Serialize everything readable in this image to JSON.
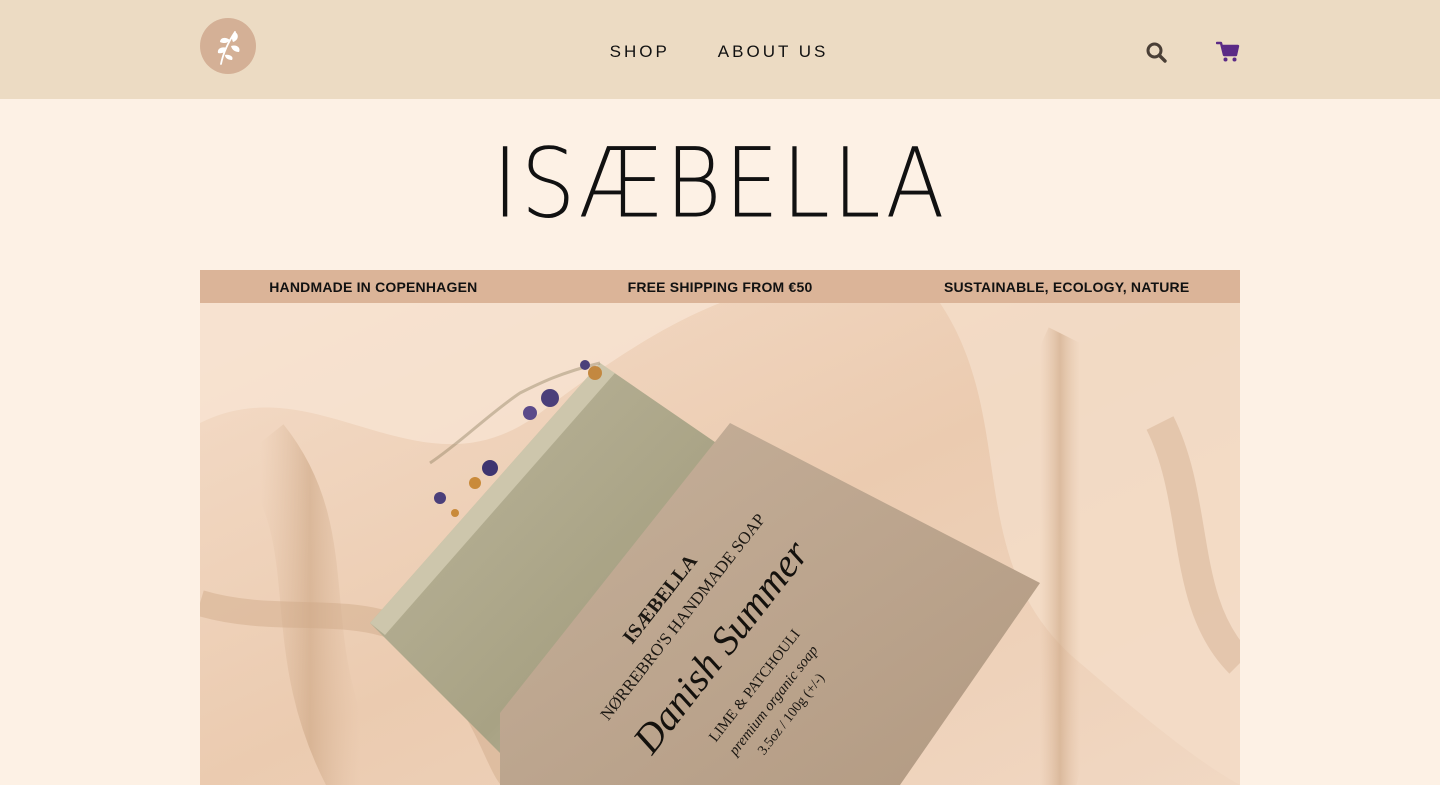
{
  "nav": {
    "links": [
      "SHOP",
      "ABOUT US"
    ],
    "logo_icon": "leaf-icon",
    "search_icon": "search-icon",
    "cart_icon": "cart-icon",
    "cart_color": "#5b2a86"
  },
  "brand": {
    "title": "ISÆBELLA"
  },
  "banner": {
    "items": [
      "HANDMADE IN COPENHAGEN",
      "FREE SHIPPING FROM €50",
      "SUSTAINABLE, ECOLOGY, NATURE"
    ]
  },
  "hero": {
    "label_brand": "ISÆBELLA",
    "label_line": "NØRREBRO'S HANDMADE SOAP",
    "label_script": "Danish Summer",
    "label_scent": "LIME & PATCHOULI",
    "label_desc": "premium organic soap",
    "label_weight": "3.5oz / 100g (+/-)"
  },
  "colors": {
    "navbar_bg": "#ecdbc3",
    "page_bg": "#fdf1e5",
    "banner_bg": "#dbb498",
    "logo_bg": "#d4b096"
  }
}
